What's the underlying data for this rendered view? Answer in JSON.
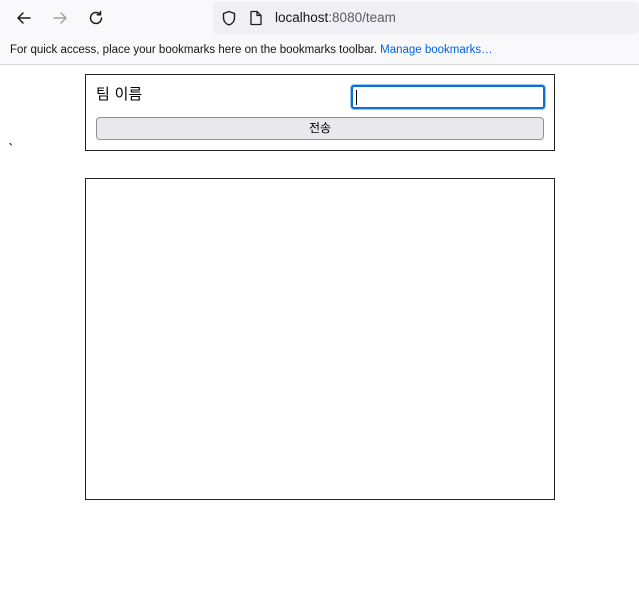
{
  "browser": {
    "url_host": "localhost",
    "url_rest": ":8080/team",
    "icons": [
      "back-arrow-icon",
      "forward-arrow-icon",
      "reload-icon",
      "shield-icon",
      "page-icon"
    ]
  },
  "bookmarks_bar": {
    "message": "For quick access, place your bookmarks here on the bookmarks toolbar.",
    "manage_link": "Manage bookmarks…"
  },
  "form": {
    "team_name_label": "팀 이름",
    "team_name_value": "",
    "submit_label": "전송"
  },
  "stray_text": "`",
  "colors": {
    "focus_ring": "#0a6fd6",
    "link": "#0061e0"
  }
}
